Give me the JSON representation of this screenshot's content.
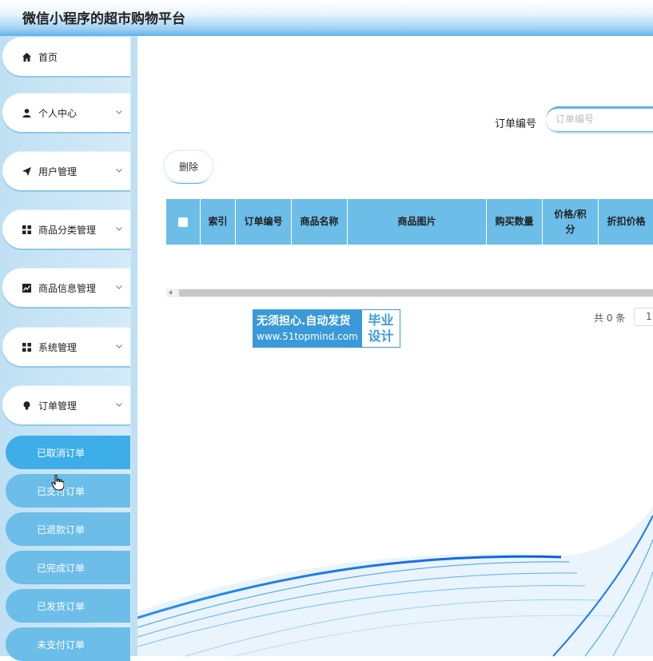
{
  "app": {
    "title": "微信小程序的超市购物平台"
  },
  "sidebar": {
    "items": [
      {
        "label": "首页",
        "icon": "home-icon",
        "has_chevron": false
      },
      {
        "label": "个人中心",
        "icon": "user-icon",
        "has_chevron": true
      },
      {
        "label": "用户管理",
        "icon": "send-icon",
        "has_chevron": true
      },
      {
        "label": "商品分类管理",
        "icon": "grid-icon",
        "has_chevron": true
      },
      {
        "label": "商品信息管理",
        "icon": "chart-icon",
        "has_chevron": true
      },
      {
        "label": "系统管理",
        "icon": "grid-icon",
        "has_chevron": true
      },
      {
        "label": "订单管理",
        "icon": "bulb-icon",
        "has_chevron": true
      }
    ],
    "sub_items": [
      {
        "label": "已取消订单",
        "active": true
      },
      {
        "label": "已支付订单",
        "active": false
      },
      {
        "label": "已退款订单",
        "active": false
      },
      {
        "label": "已完成订单",
        "active": false
      },
      {
        "label": "已发货订单",
        "active": false
      },
      {
        "label": "未支付订单",
        "active": false
      }
    ]
  },
  "search": {
    "label": "订单编号",
    "placeholder": "订单编号"
  },
  "toolbar": {
    "delete_label": "删除"
  },
  "table": {
    "columns": [
      "",
      "索引",
      "订单编号",
      "商品名称",
      "商品图片",
      "购买数量",
      "价格/积分",
      "折扣价格"
    ],
    "rows": []
  },
  "pagination": {
    "total_label": "共 0 条",
    "page_size": "1"
  },
  "watermark": {
    "line1": "无须担心.自动发货",
    "line2": "www.51topmind.com",
    "right1": "毕业",
    "right2": "设计"
  },
  "colors": {
    "accent": "#6cbde8",
    "active": "#3eaee8",
    "header_bottom": "#5eb2ea"
  }
}
